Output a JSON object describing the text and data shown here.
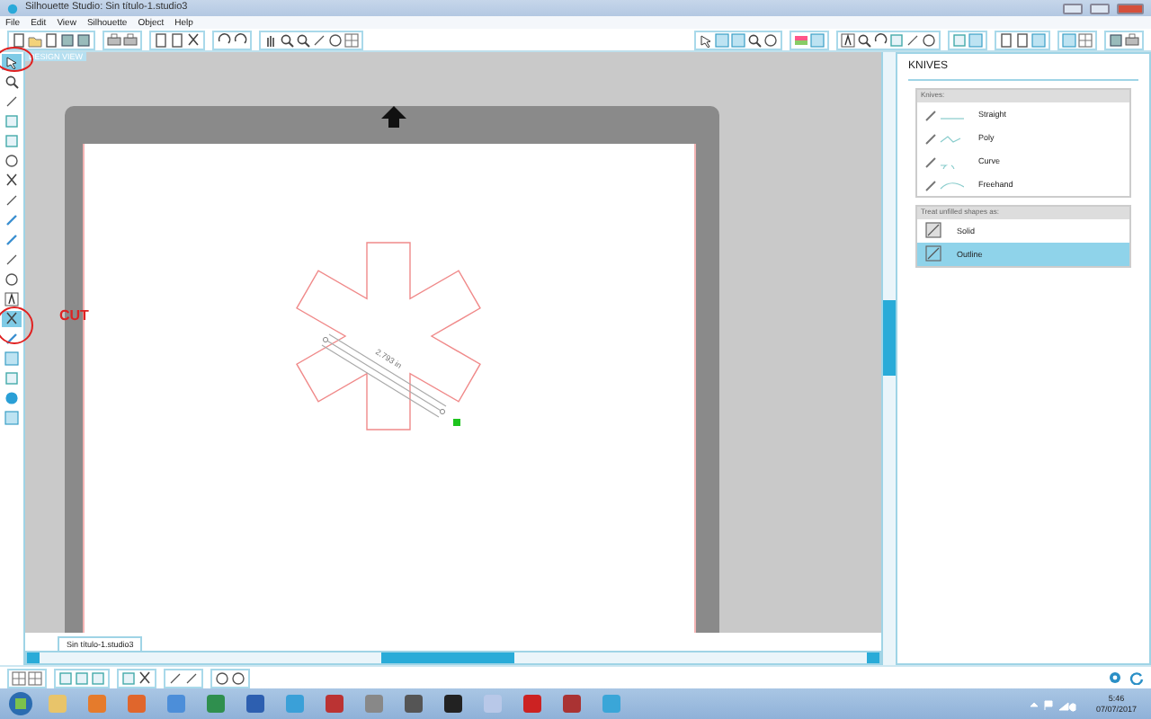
{
  "window": {
    "title": "Silhouette Studio: Sin título-1.studio3"
  },
  "menu": [
    "File",
    "Edit",
    "View",
    "Silhouette",
    "Object",
    "Help"
  ],
  "left_tools": [
    {
      "selected": true
    },
    {
      "selected": false
    },
    {
      "selected": false
    },
    {
      "selected": false
    },
    {
      "selected": false
    },
    {
      "selected": false
    },
    {
      "selected": false
    },
    {
      "selected": false
    },
    {
      "selected": false
    },
    {
      "selected": false
    },
    {
      "selected": false
    },
    {
      "selected": false
    },
    {
      "selected": false
    },
    {
      "selected": true
    },
    {
      "selected": false
    },
    {
      "selected": false
    },
    {
      "selected": false
    },
    {
      "selected": false
    },
    {
      "selected": false
    }
  ],
  "canvas": {
    "view_label": "DESIGN VIEW",
    "dimension": "2.793 in"
  },
  "annotation": {
    "label": "CUT"
  },
  "document_tab": {
    "label": "Sin título-1.studio3"
  },
  "panel": {
    "title": "KNIVES",
    "knives_label": "Knives:",
    "knives": [
      {
        "label": "Straight",
        "selected": false
      },
      {
        "label": "Poly",
        "selected": false
      },
      {
        "label": "Curve",
        "selected": false
      },
      {
        "label": "Freehand",
        "selected": false
      }
    ],
    "treat_label": "Treat unfilled shapes as:",
    "treat_options": [
      {
        "label": "Solid",
        "selected": false
      },
      {
        "label": "Outline",
        "selected": true
      }
    ]
  },
  "taskbar": {
    "time": "5:46",
    "date": "07/07/2017"
  }
}
